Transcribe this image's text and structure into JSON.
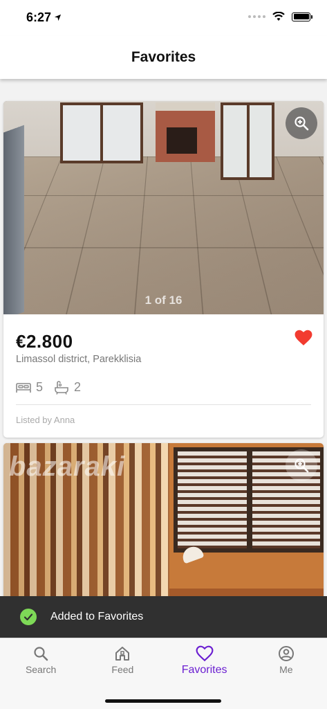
{
  "status_bar": {
    "time": "6:27"
  },
  "header": {
    "title": "Favorites"
  },
  "listings": [
    {
      "photo_counter": "1 of 16",
      "price": "€2.800",
      "location": "Limassol district, Parekklisia",
      "bedrooms": "5",
      "bathrooms": "2",
      "listed_by": "Listed by Anna",
      "favorited": true
    },
    {
      "watermark": "bazaraki"
    }
  ],
  "snackbar": {
    "text": "Added to Favorites"
  },
  "bottom_nav": {
    "items": [
      {
        "label": "Search",
        "icon": "search-icon"
      },
      {
        "label": "Feed",
        "icon": "home-icon"
      },
      {
        "label": "Favorites",
        "icon": "heart-icon",
        "active": true
      },
      {
        "label": "Me",
        "icon": "account-icon"
      }
    ]
  },
  "colors": {
    "accent": "#6b1fd1",
    "heart": "#f23b30",
    "snackbar_bg": "#303030",
    "success": "#7ed957"
  }
}
